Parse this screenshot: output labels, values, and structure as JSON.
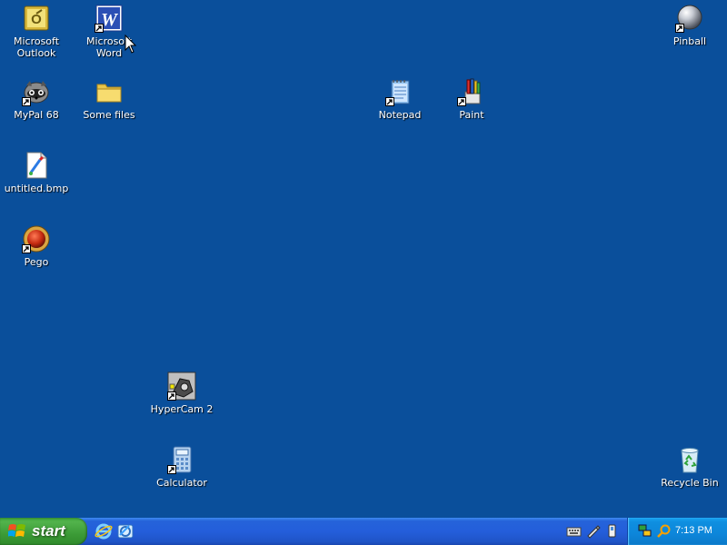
{
  "desktop": {
    "icons": [
      {
        "id": "outlook",
        "label": "Microsoft Outlook",
        "icon": "outlook-icon",
        "shortcut": false
      },
      {
        "id": "word",
        "label": "Microsoft Word",
        "icon": "word-icon",
        "shortcut": true
      },
      {
        "id": "pinball",
        "label": "Pinball",
        "icon": "pinball-icon",
        "shortcut": true
      },
      {
        "id": "mypal",
        "label": "MyPal 68",
        "icon": "mypal-icon",
        "shortcut": true
      },
      {
        "id": "somefiles",
        "label": "Some files",
        "icon": "folder-icon",
        "shortcut": false
      },
      {
        "id": "notepad",
        "label": "Notepad",
        "icon": "notepad-icon",
        "shortcut": true
      },
      {
        "id": "paint",
        "label": "Paint",
        "icon": "paint-icon",
        "shortcut": true
      },
      {
        "id": "untitled",
        "label": "untitled.bmp",
        "icon": "bitmap-icon",
        "shortcut": false
      },
      {
        "id": "pego",
        "label": "Pego",
        "icon": "pego-icon",
        "shortcut": true
      },
      {
        "id": "hypercam",
        "label": "HyperCam 2",
        "icon": "hypercam-icon",
        "shortcut": true
      },
      {
        "id": "calculator",
        "label": "Calculator",
        "icon": "calculator-icon",
        "shortcut": true
      },
      {
        "id": "recyclebin",
        "label": "Recycle Bin",
        "icon": "recycle-bin-icon",
        "shortcut": false
      }
    ]
  },
  "taskbar": {
    "start_label": "start",
    "clock": "7:13 PM"
  },
  "colors": {
    "desktop_background": "#0a4f9b",
    "taskbar_blue": "#245edb",
    "start_green": "#3c9b37",
    "tray_blue": "#0d86da"
  }
}
